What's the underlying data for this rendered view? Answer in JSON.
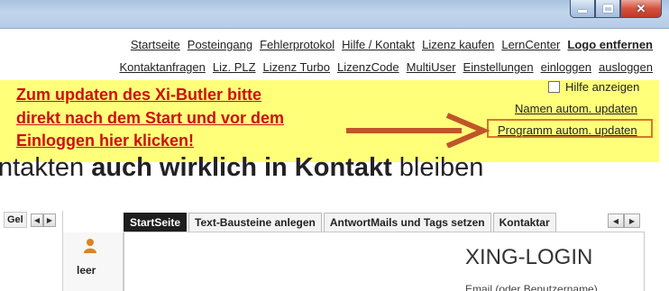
{
  "window": {
    "controls": [
      "minimize",
      "maximize",
      "close"
    ],
    "close_glyph": "✕"
  },
  "nav": {
    "row1": [
      {
        "label": "Startseite"
      },
      {
        "label": "Posteingang"
      },
      {
        "label": "Fehlerprotokol"
      },
      {
        "label": "Hilfe / Kontakt"
      },
      {
        "label": "Lizenz kaufen"
      },
      {
        "label": "LernCenter"
      },
      {
        "label": "Logo entfernen",
        "bold": true
      }
    ],
    "row2": [
      {
        "label": "Kontaktanfragen"
      },
      {
        "label": "Liz. PLZ"
      },
      {
        "label": "Lizenz Turbo"
      },
      {
        "label": "LizenzCode"
      },
      {
        "label": "MultiUser"
      },
      {
        "label": "Einstellungen"
      },
      {
        "label": "einloggen"
      },
      {
        "label": "ausloggen"
      }
    ]
  },
  "annotation": {
    "lines": [
      "Zum updaten des Xi-Butler bitte",
      "direkt nach dem Start und vor dem",
      "Einloggen hier klicken!"
    ],
    "color": "#cc1010",
    "highlight_color": "#ffff7a",
    "arrow_color": "#c0552a"
  },
  "options": {
    "help_label": "Hilfe anzeigen",
    "help_checked": false,
    "update_names_label": "Namen autom. updaten",
    "update_program_label": "Programm autom. updaten"
  },
  "slogan": {
    "prefix": "ntakten ",
    "bold": "auch wirklich in Kontakt",
    "suffix": " bleiben"
  },
  "left_panel": {
    "tab_label": "Gel",
    "user_label": "leer"
  },
  "tabs": [
    {
      "label": "StartSeite",
      "active": true
    },
    {
      "label": "Text-Bausteine anlegen"
    },
    {
      "label": "AntwortMails und Tags setzen"
    },
    {
      "label": "Kontaktar"
    }
  ],
  "login": {
    "title": "XING-LOGIN",
    "email_label": "Email (oder Benutzername)"
  },
  "scroll_arrows": {
    "left": "◀",
    "right": "▶"
  }
}
